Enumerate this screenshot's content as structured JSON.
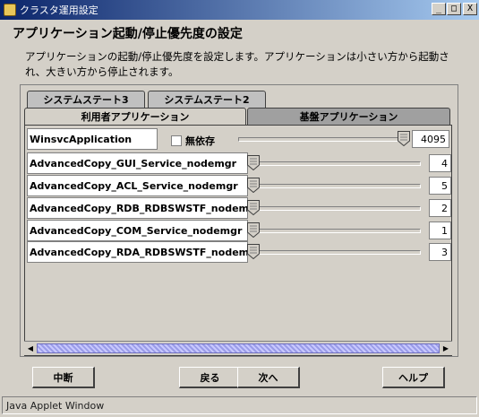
{
  "window": {
    "title": "クラスタ運用設定",
    "minimize": "_",
    "maximize": "□",
    "close": "X"
  },
  "page": {
    "title": "アプリケーション起動/停止優先度の設定",
    "description": "アプリケーションの起動/停止優先度を設定します。アプリケーションは小さい方から起動され、大きい方から停止されます。"
  },
  "tabs": {
    "row1": [
      "システムステート3",
      "システムステート2"
    ],
    "row2": [
      "利用者アプリケーション",
      "基盤アプリケーション"
    ],
    "active": "利用者アプリケーション"
  },
  "table": {
    "rows": [
      {
        "name": "WinsvcApplication",
        "checkbox_label": "無依存",
        "checked": false,
        "value": "4095",
        "slider_fraction": 1.0
      },
      {
        "name": "AdvancedCopy_GUI_Service_nodemgr",
        "value": "4",
        "slider_fraction": 0.0
      },
      {
        "name": "AdvancedCopy_ACL_Service_nodemgr",
        "value": "5",
        "slider_fraction": 0.0
      },
      {
        "name": "AdvancedCopy_RDB_RDBSWSTF_nodemgr",
        "value": "2",
        "slider_fraction": 0.0
      },
      {
        "name": "AdvancedCopy_COM_Service_nodemgr",
        "value": "1",
        "slider_fraction": 0.0
      },
      {
        "name": "AdvancedCopy_RDA_RDBSWSTF_nodemgr",
        "value": "3",
        "slider_fraction": 0.0
      }
    ]
  },
  "scrollbar": {
    "left_arrow": "◀",
    "right_arrow": "▶"
  },
  "buttons": {
    "abort": "中断",
    "back": "戻る",
    "next": "次へ",
    "help": "ヘルプ"
  },
  "status": "Java Applet Window"
}
